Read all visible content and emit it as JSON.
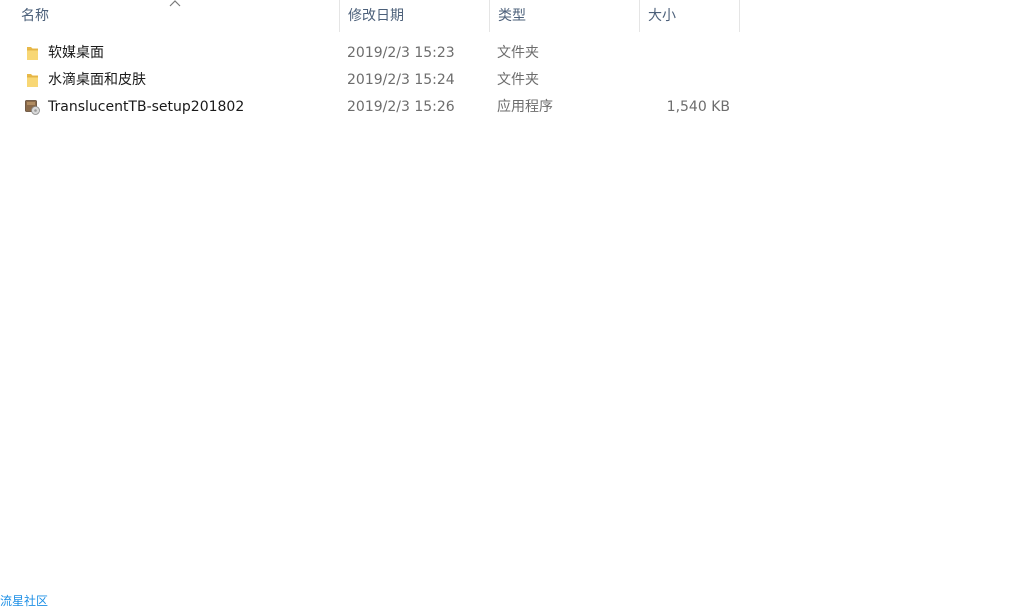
{
  "columns": {
    "name": "名称",
    "date": "修改日期",
    "type": "类型",
    "size": "大小"
  },
  "sort": {
    "column": "name",
    "direction": "ascending",
    "icon": "chevron-up-icon"
  },
  "files": [
    {
      "icon": "folder-icon",
      "name": "软媒桌面",
      "date": "2019/2/3 15:23",
      "type": "文件夹",
      "size": ""
    },
    {
      "icon": "folder-icon",
      "name": "水滴桌面和皮肤",
      "date": "2019/2/3 15:24",
      "type": "文件夹",
      "size": ""
    },
    {
      "icon": "installer-icon",
      "name": "TranslucentTB-setup201802",
      "date": "2019/2/3 15:26",
      "type": "应用程序",
      "size": "1,540 KB"
    }
  ],
  "watermark": "流星社区",
  "colors": {
    "header_text": "#4c607a",
    "secondary_text": "#6d6d6d",
    "folder_yellow": "#f8d775",
    "watermark": "#1e90e6"
  }
}
